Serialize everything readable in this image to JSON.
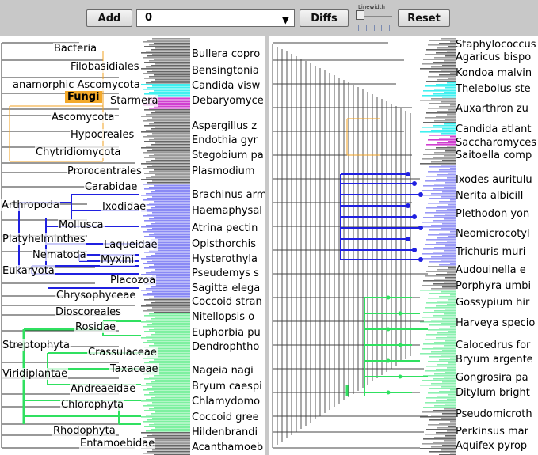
{
  "toolbar": {
    "add_label": "Add",
    "combo_value": "0",
    "diffs_label": "Diffs",
    "linewidth_label": "Linewidth",
    "reset_label": "Reset"
  },
  "colors": {
    "fungi": "#f0a020",
    "arthropoda": "#2020e0",
    "viridiplantae": "#30e060",
    "cyan": "#40f0f0",
    "magenta": "#d040d0"
  },
  "left_tree": {
    "inner_labels": [
      "Bacteria",
      "Filobasidiales",
      "anamorphic Ascomycota",
      "Fungi",
      "Starmera",
      "Ascomycota",
      "Hypocreales",
      "Chytridiomycota",
      "Prorocentrales",
      "Carabidae",
      "Arthropoda",
      "Ixodidae",
      "Mollusca",
      "Platyhelminthes",
      "Laqueidae",
      "Nematoda",
      "Myxini",
      "Eukaryota",
      "Placozoa",
      "Chrysophyceae",
      "Dioscoreales",
      "Rosidae",
      "Streptophyta",
      "Crassulaceae",
      "Taxaceae",
      "Viridiplantae",
      "Andreaeidae",
      "Chlorophyta",
      "Rhodophyta",
      "Entamoebidae"
    ],
    "leaf_labels": [
      "Bullera copro",
      "Bensingtonia",
      "Candida visw",
      "Debaryomyce",
      "Aspergillus z",
      "Endothia gyr",
      "Stegobium pa",
      "Plasmodium",
      "Brachinus arm",
      "Haemaphysal",
      "Atrina pectin",
      "Opisthorchis",
      "Hysterothyla",
      "Pseudemys s",
      "Sagitta elega",
      "Coccoid stran",
      "Nitellopsis o",
      "Euphorbia pu",
      "Dendrophtho",
      "Nageia nagi",
      "Bryum caespi",
      "Chlamydomo",
      "Coccoid gree",
      "Hildenbrandi",
      "Acanthamoeb"
    ]
  },
  "right_tree": {
    "leaf_labels": [
      "Staphylococcus",
      "Agaricus bispo",
      "Kondoa malvin",
      "Thelebolus ste",
      "Auxarthron zu",
      "Candida atlant",
      "Saccharomyces",
      "Saitoella comp",
      "Ixodes auritulu",
      "Nerita albicill",
      "Plethodon yon",
      "Neomicrocotyl",
      "Trichuris muri",
      "Audouinella e",
      "Porphyra umbi",
      "Gossypium hir",
      "Harveya specio",
      "Calocedrus for",
      "Bryum argente",
      "Gongrosira pa",
      "Ditylum bright",
      "Pseudomicroth",
      "Perkinsus mar",
      "Aquifex pyrop"
    ]
  }
}
